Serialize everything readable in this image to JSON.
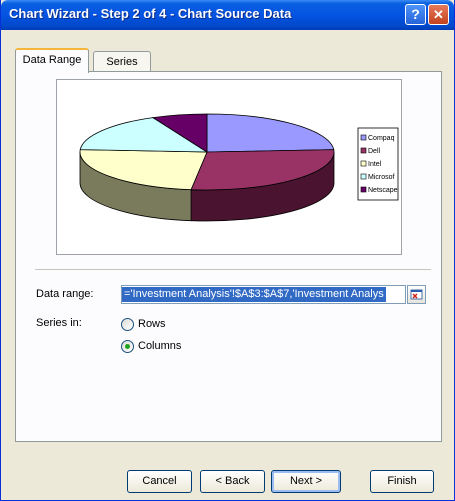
{
  "window": {
    "title": "Chart Wizard - Step 2 of 4 - Chart Source Data",
    "help": "?",
    "close": "✕"
  },
  "tabs": [
    {
      "label": "Data Range",
      "active": true
    },
    {
      "label": "Series",
      "active": false
    }
  ],
  "chart_data": {
    "type": "pie",
    "categories": [
      "Compaq",
      "Dell",
      "Intel",
      "Microsoft",
      "Netscape"
    ],
    "legend_labels": [
      "Compaq",
      "Dell",
      "Intel",
      "Microsof",
      "Netscape"
    ],
    "values": [
      24,
      28,
      24,
      17,
      7
    ],
    "colors": [
      "#9999ff",
      "#993366",
      "#ffffcc",
      "#ccffff",
      "#660066"
    ],
    "side_colors": [
      "#5f5fa0",
      "#4a1430",
      "#7a7a5c",
      "#5f8a8a",
      "#2c002c"
    ],
    "legend_position": "right",
    "style": "3d"
  },
  "form": {
    "data_range_label": "Data range:",
    "data_range_value": "='Investment Analysis'!$A$3:$A$7,'Investment Analys",
    "series_in_label": "Series in:",
    "rows_label": "Rows",
    "columns_label": "Columns",
    "series_in_selected": "Columns"
  },
  "buttons": {
    "cancel": "Cancel",
    "back": "< Back",
    "next": "Next >",
    "finish": "Finish"
  }
}
